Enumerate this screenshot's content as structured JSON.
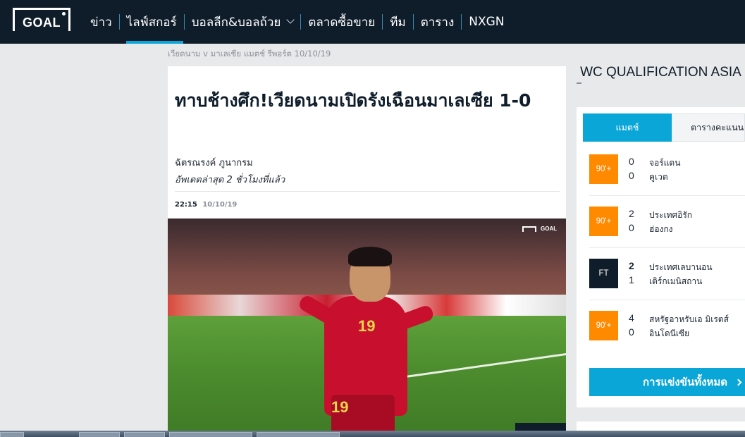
{
  "nav": {
    "logo": "GOAL",
    "items": [
      {
        "label": "ข่าว"
      },
      {
        "label": "ไลฟ์สกอร์"
      },
      {
        "label": "บอลลีก&บอลถ้วย"
      },
      {
        "label": "ตลาดซื้อขาย"
      },
      {
        "label": "ทีม"
      },
      {
        "label": "ตาราง"
      },
      {
        "label": "NXGN"
      }
    ],
    "active_index": 1
  },
  "breadcrumb": "เวียดนาม v มาเลเซีย แมตช์ รีพอร์ต 10/10/19",
  "article": {
    "headline": "ทาบช้างศึก!เวียดนามเปิดรังเฉือนมาเลเซีย 1-0",
    "author": "ฉัตรณรงค์ ภูนากรม",
    "updated": "อัพเดตล่าสุด 2 ชั่วโมงที่แล้ว",
    "time": "22:15",
    "date": "10/10/19",
    "photo": {
      "logo": "GOAL",
      "jersey_number": "19",
      "shorts_number": "19"
    }
  },
  "sidebar": {
    "title": "WC QUALIFICATION ASIA",
    "tabs": [
      {
        "label": "แมตช์",
        "active": true
      },
      {
        "label": "ตารางคะแนน",
        "active": false
      }
    ],
    "matches": [
      {
        "status": "90'+",
        "status_type": "live",
        "home": "จอร์แดน",
        "away": "คูเวต",
        "home_score": "0",
        "away_score": "0",
        "winner": ""
      },
      {
        "status": "90'+",
        "status_type": "live",
        "home": "ประเทศอิรัก",
        "away": "ฮ่องกง",
        "home_score": "2",
        "away_score": "0",
        "winner": ""
      },
      {
        "status": "FT",
        "status_type": "ft",
        "home": "ประเทศเลบานอน",
        "away": "เติร์กเมนิสถาน",
        "home_score": "2",
        "away_score": "1",
        "winner": "home"
      },
      {
        "status": "90'+",
        "status_type": "live",
        "home": "สหรัฐอาหรับเอ มิเรตส์",
        "away": "อินโดนีเซีย",
        "home_score": "4",
        "away_score": "0",
        "winner": ""
      }
    ],
    "all_competitions_label": "การแข่งขันทั้งหมด"
  },
  "colors": {
    "nav_bg": "#0f1d2b",
    "accent": "#0aa6d8",
    "live": "#ff8a00",
    "ft": "#0f1d2b",
    "page_bg": "#e8e9ea"
  }
}
